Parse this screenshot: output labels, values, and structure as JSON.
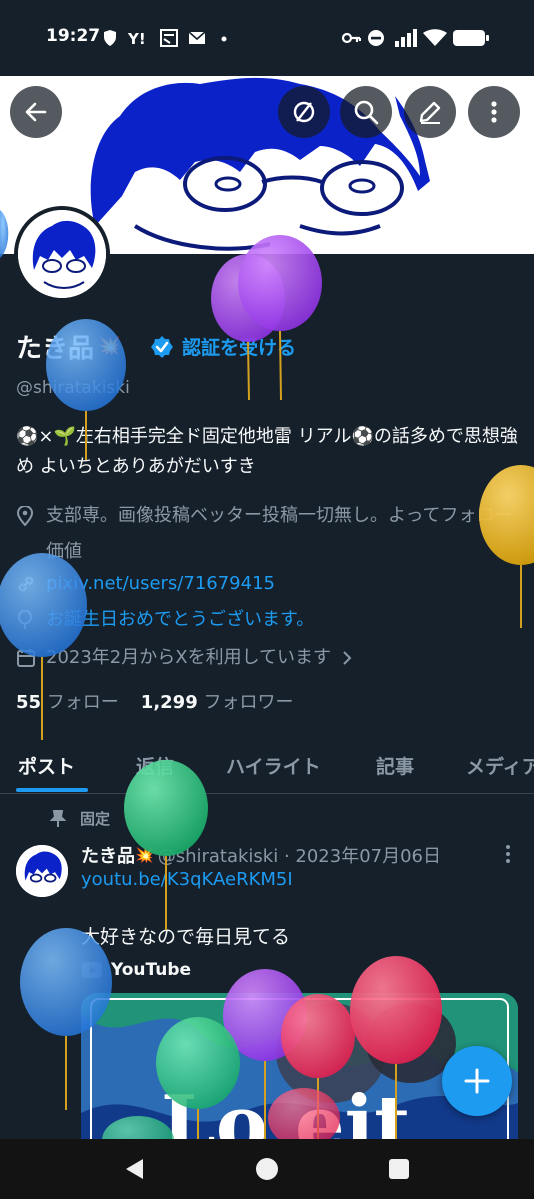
{
  "status_bar": {
    "time": "19:27",
    "left_icons": [
      "shield-icon",
      "yahoo-icon",
      "news-icon",
      "mail-icon",
      "dot-icon"
    ],
    "right_icons": [
      "key-icon",
      "dnd-icon",
      "signal-icon",
      "wifi-icon",
      "battery-icon"
    ]
  },
  "header": {
    "back_icon": "arrow-left-icon",
    "actions": [
      "mute-icon",
      "search-icon",
      "edit-icon",
      "more-icon"
    ]
  },
  "profile": {
    "name": "たき品",
    "name_emoji": "💥",
    "verify_label": "認証を受ける",
    "handle": "@shiratakiski",
    "bio": "⚽×🌱左右相手完全ド固定他地雷 リアル⚽の話多めで思想強め よいちとありあがだいすき",
    "location": "支部専。画像投稿ベッター投稿一切無し。よってフォロー価値",
    "website": "pixiv.net/users/71679415",
    "birthday": "お誕生日おめでとうございます。",
    "joined": "2023年2月からXを利用しています",
    "following_count": "55",
    "following_label": "フォロー",
    "followers_count": "1,299",
    "followers_label": "フォロワー"
  },
  "tabs": [
    {
      "label": "ポスト",
      "active": true
    },
    {
      "label": "返信",
      "active": false
    },
    {
      "label": "ハイライト",
      "active": false
    },
    {
      "label": "記事",
      "active": false
    },
    {
      "label": "メディア",
      "active": false
    }
  ],
  "pinned_post": {
    "pinned_label": "固定",
    "author_name": "たき品",
    "author_emoji": "💥",
    "meta": "@shiratakiski · 2023年07月06日",
    "link": "youtu.be/K3qKAeRKM5I",
    "text": "大好きなので毎日見てる",
    "source": "YouTube",
    "card_text": "Lo eit"
  },
  "fab_icon": "plus-icon",
  "colors": {
    "background": "#15202b",
    "accent": "#1d9bf0",
    "text_secondary": "#8b98a5"
  }
}
